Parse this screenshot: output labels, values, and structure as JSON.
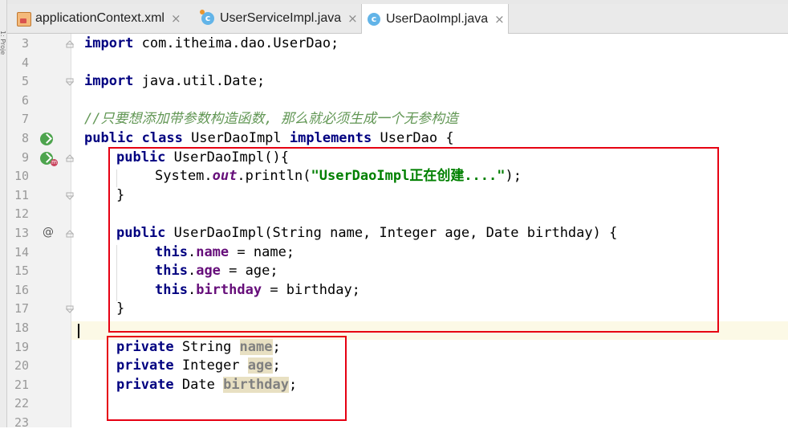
{
  "tabs": [
    {
      "label": "applicationContext.xml",
      "icon": "xml-file-icon",
      "active": false
    },
    {
      "label": "UserServiceImpl.java",
      "icon": "java-class-icon",
      "active": false
    },
    {
      "label": "UserDaoImpl.java",
      "icon": "java-class-icon",
      "active": true
    }
  ],
  "close_glyph": "×",
  "sidebar_label": "1: Proje",
  "colors": {
    "keyword": "#000080",
    "field": "#660e7a",
    "string": "#008000",
    "comment": "#629755",
    "highlight_box": "#e60012",
    "current_line": "#fcf9e6"
  },
  "lines": {
    "l3": {
      "num": "3",
      "kw": "import",
      "rest": " com.itheima.dao.UserDao;"
    },
    "l4": {
      "num": "4"
    },
    "l5": {
      "num": "5",
      "kw": "import",
      "rest": " java.util.Date;"
    },
    "l6": {
      "num": "6"
    },
    "l7": {
      "num": "7",
      "comment": "//只要想添加带参数构造函数, 那么就必须生成一个无参构造"
    },
    "l8": {
      "num": "8",
      "kw1": "public class",
      "cls": " UserDaoImpl ",
      "kw2": "implements",
      "rest": " UserDao {"
    },
    "l9": {
      "num": "9",
      "kw": "public",
      "rest": " UserDaoImpl(){"
    },
    "l10": {
      "num": "10",
      "pre": "System.",
      "stat": "out",
      "mid": ".println(",
      "str": "\"UserDaoImpl正在创建....\"",
      "rest": ");"
    },
    "l11": {
      "num": "11",
      "rest": "}"
    },
    "l12": {
      "num": "12"
    },
    "l13": {
      "num": "13",
      "kw": "public",
      "rest": " UserDaoImpl(String name, Integer age, Date birthday) {"
    },
    "l14": {
      "num": "14",
      "kw": "this",
      "dot": ".",
      "fld": "name",
      "rest": " = name;"
    },
    "l15": {
      "num": "15",
      "kw": "this",
      "dot": ".",
      "fld": "age",
      "rest": " = age;"
    },
    "l16": {
      "num": "16",
      "kw": "this",
      "dot": ".",
      "fld": "birthday",
      "rest": " = birthday;"
    },
    "l17": {
      "num": "17",
      "rest": "}"
    },
    "l18": {
      "num": "18"
    },
    "l19": {
      "num": "19",
      "kw": "private",
      "type": " String ",
      "fld": "name",
      "rest": ";"
    },
    "l20": {
      "num": "20",
      "kw": "private",
      "type": " Integer ",
      "fld": "age",
      "rest": ";"
    },
    "l21": {
      "num": "21",
      "kw": "private",
      "type": " Date ",
      "fld": "birthday",
      "rest": ";"
    },
    "l22": {
      "num": "22"
    },
    "l23": {
      "num": "23"
    }
  },
  "gutter_marks": {
    "l8": "implements-interface-icon",
    "l9": "override-method-icon",
    "l13": "@"
  }
}
